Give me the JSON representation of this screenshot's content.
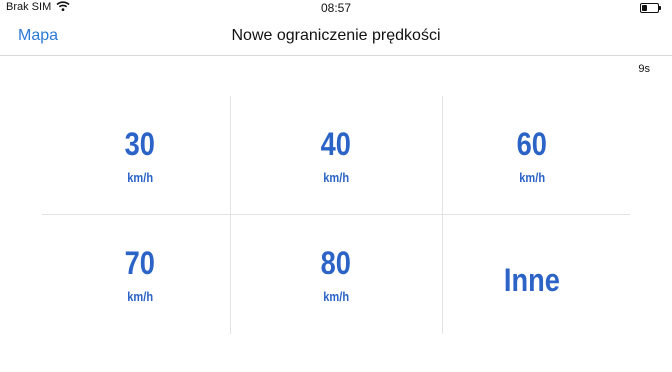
{
  "status_bar": {
    "carrier": "Brak SIM",
    "time": "08:57",
    "wifi_icon": "wifi-icon",
    "battery_icon": "battery-icon"
  },
  "nav": {
    "back_label": "Mapa",
    "title": "Nowe ograniczenie prędkości"
  },
  "countdown": "9s",
  "options": [
    {
      "value": "30",
      "unit": "km/h"
    },
    {
      "value": "40",
      "unit": "km/h"
    },
    {
      "value": "60",
      "unit": "km/h"
    },
    {
      "value": "70",
      "unit": "km/h"
    },
    {
      "value": "80",
      "unit": "km/h"
    }
  ],
  "other_label": "Inne",
  "colors": {
    "accent": "#2b63c6",
    "link": "#2a7ad8",
    "divider": "#e3e3e3"
  }
}
